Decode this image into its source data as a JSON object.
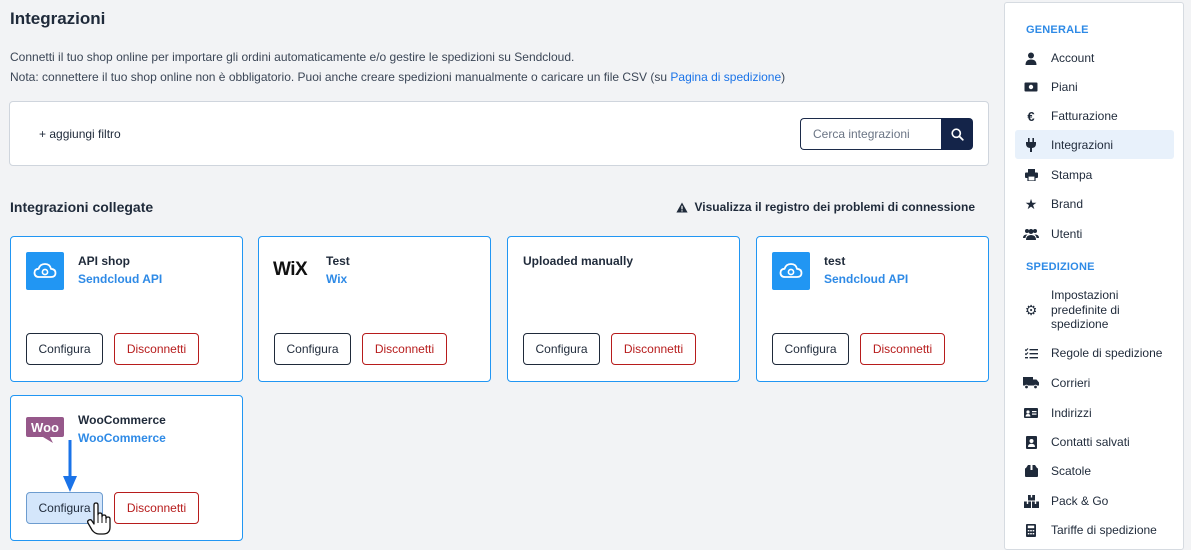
{
  "header": {
    "title": "Integrazioni",
    "desc1": "Connetti il tuo shop online per importare gli ordini automaticamente e/o gestire le spedizioni su Sendcloud.",
    "desc2_prefix": "Nota: connettere il tuo shop online non è obbligatorio. Puoi anche creare spedizioni manualmente o caricare un file CSV (su ",
    "desc2_link": "Pagina di spedizione",
    "desc2_suffix": ")"
  },
  "filter": {
    "add_filter_label": "+ aggiungi filtro",
    "search_placeholder": "Cerca integrazioni"
  },
  "connected": {
    "title": "Integrazioni collegate",
    "log_link": "Visualizza il registro dei problemi di connessione"
  },
  "cards": [
    {
      "name": "API shop",
      "sub": "Sendcloud API",
      "logo": "sendcloud-cloud-icon",
      "configure": "Configura",
      "disconnect": "Disconnetti"
    },
    {
      "name": "Test",
      "sub": "Wix",
      "logo": "WiX",
      "configure": "Configura",
      "disconnect": "Disconnetti"
    },
    {
      "name": "Uploaded manually",
      "sub": "",
      "logo": "",
      "configure": "Configura",
      "disconnect": "Disconnetti"
    },
    {
      "name": "test",
      "sub": "Sendcloud API",
      "logo": "sendcloud-cloud-icon",
      "configure": "Configura",
      "disconnect": "Disconnetti"
    },
    {
      "name": "WooCommerce",
      "sub": "WooCommerce",
      "logo": "Woo",
      "configure": "Configura",
      "disconnect": "Disconnetti"
    }
  ],
  "sidebar": {
    "general_heading": "GENERALE",
    "general_items": [
      {
        "label": "Account",
        "icon": "user-icon"
      },
      {
        "label": "Piani",
        "icon": "money-icon"
      },
      {
        "label": "Fatturazione",
        "icon": "euro-icon"
      },
      {
        "label": "Integrazioni",
        "icon": "plug-icon",
        "active": true
      },
      {
        "label": "Stampa",
        "icon": "printer-icon"
      },
      {
        "label": "Brand",
        "icon": "star-icon"
      },
      {
        "label": "Utenti",
        "icon": "users-icon"
      }
    ],
    "shipping_heading": "SPEDIZIONE",
    "shipping_items": [
      {
        "label": "Impostazioni predefinite di spedizione",
        "icon": "gear-icon"
      },
      {
        "label": "Regole di spedizione",
        "icon": "list-check-icon"
      },
      {
        "label": "Corrieri",
        "icon": "truck-icon"
      },
      {
        "label": "Indirizzi",
        "icon": "id-card-icon"
      },
      {
        "label": "Contatti salvati",
        "icon": "contact-book-icon"
      },
      {
        "label": "Scatole",
        "icon": "box-icon"
      },
      {
        "label": "Pack & Go",
        "icon": "boxes-icon"
      },
      {
        "label": "Tariffe di spedizione",
        "icon": "calculator-icon"
      }
    ]
  },
  "colors": {
    "accent": "#2196f3",
    "navy": "#142449",
    "danger": "#b71c1c",
    "woo": "#96588a"
  }
}
